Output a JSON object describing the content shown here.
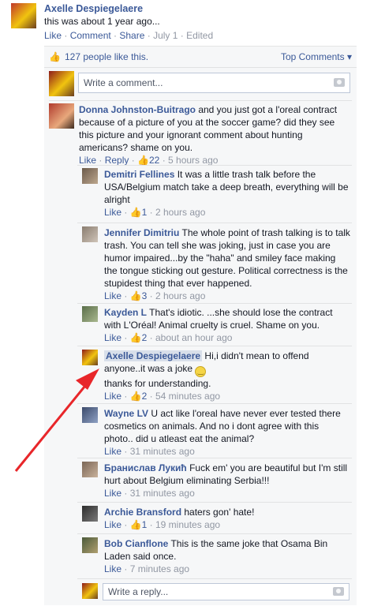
{
  "post": {
    "author": "Axelle Despiegelaere",
    "text": "this was about 1 year ago...",
    "like": "Like",
    "comment": "Comment",
    "share": "Share",
    "date": "July 1",
    "edited": "Edited"
  },
  "likes": {
    "text": "127 people like this.",
    "top_comments": "Top Comments ▾"
  },
  "write_comment": {
    "placeholder": "Write a comment..."
  },
  "comments": [
    {
      "author": "Donna Johnston-Buitrago",
      "text": "and you just got a l'oreal contract because of a picture of you at the soccer game? did they see this picture and your ignorant comment about hunting americans? shame on you.",
      "like": "Like",
      "reply": "Reply",
      "likes": "22",
      "time": "5 hours ago"
    }
  ],
  "replies": [
    {
      "author": "Demitri Fellines",
      "text": "It was a little trash talk before the USA/Belgium match take a deep breath, everything will be alright",
      "like": "Like",
      "likes": "1",
      "time": "2 hours ago"
    },
    {
      "author": "Jennifer Dimitriu",
      "text": "The whole point of trash talking is to talk trash. You can tell she was joking, just in case you are humor impaired...by the \"haha\" and smiley face making the tongue sticking out gesture. Political correctness is the stupidest thing that ever happened.",
      "like": "Like",
      "likes": "3",
      "time": "2 hours ago"
    },
    {
      "author": "Kayden L",
      "text": "That's idiotic. ...she should lose the contract with L'Oréal! Animal cruelty is cruel. Shame on you.",
      "like": "Like",
      "likes": "2",
      "time": "about an hour ago"
    },
    {
      "author": "Axelle Despiegelaere",
      "text": "Hi,i didn't mean to offend anyone..it was a joke",
      "text2": "thanks for understanding.",
      "like": "Like",
      "likes": "2",
      "time": "54 minutes ago"
    },
    {
      "author": "Wayne LV",
      "text": "U act like l'oreal have never ever tested there cosmetics on animals. And no i dont agree with this photo.. did u atleast eat the animal?",
      "like": "Like",
      "time": "31 minutes ago"
    },
    {
      "author": "Бранислав Лукић",
      "text": "Fuck em' you are beautiful but I'm still hurt about Belgium eliminating Serbia!!!",
      "like": "Like",
      "time": "31 minutes ago"
    },
    {
      "author": "Archie Bransford",
      "text": "haters gon' hate!",
      "like": "Like",
      "likes": "1",
      "time": "19 minutes ago"
    },
    {
      "author": "Bob Cianflone",
      "text": "This is the same joke that Osama Bin Laden said once.",
      "like": "Like",
      "time": "7 minutes ago"
    }
  ],
  "write_reply": {
    "placeholder": "Write a reply..."
  },
  "colors": {
    "link": "#3b5998",
    "panel": "#f6f7f8",
    "arrow": "#e8262a"
  }
}
